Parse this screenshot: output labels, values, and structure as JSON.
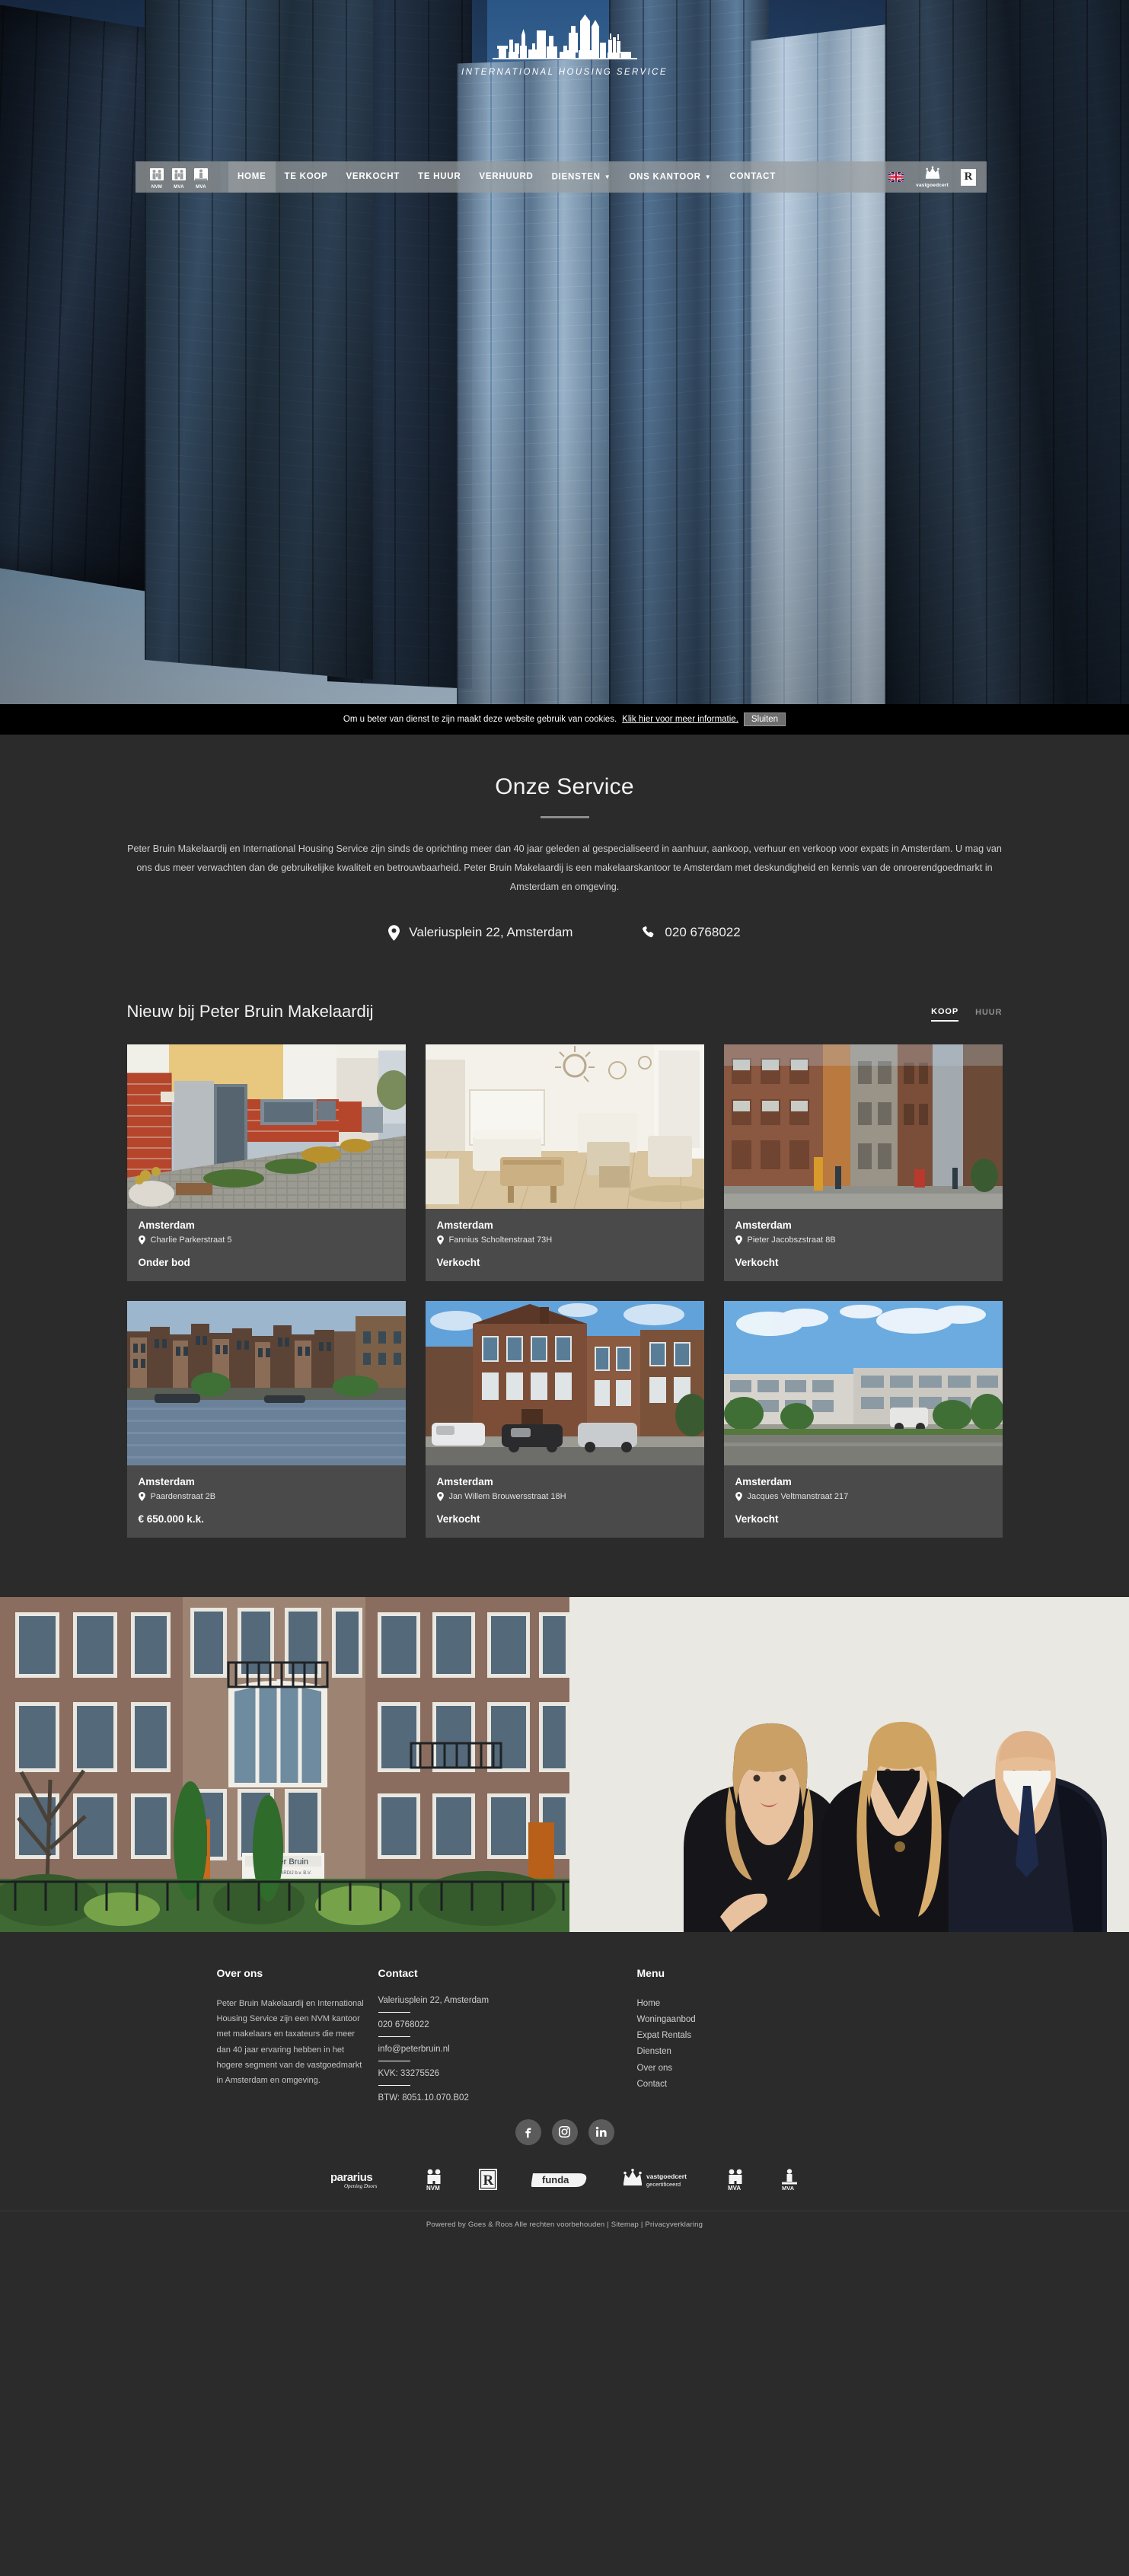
{
  "header": {
    "logo_text": "INTERNATIONAL HOUSING SERVICE",
    "badges": [
      "NVM",
      "MVA",
      "MVA"
    ],
    "nav": [
      {
        "label": "HOME",
        "has_caret": false,
        "active": true
      },
      {
        "label": "TE KOOP",
        "has_caret": false,
        "active": false
      },
      {
        "label": "VERKOCHT",
        "has_caret": false,
        "active": false
      },
      {
        "label": "TE HUUR",
        "has_caret": false,
        "active": false
      },
      {
        "label": "VERHUURD",
        "has_caret": false,
        "active": false
      },
      {
        "label": "DIENSTEN",
        "has_caret": true,
        "active": false
      },
      {
        "label": "ONS KANTOOR",
        "has_caret": true,
        "active": false
      },
      {
        "label": "CONTACT",
        "has_caret": false,
        "active": false
      }
    ],
    "lang_flag": "uk-flag-icon",
    "cert_label": "vastgoedcert",
    "register_mark": "R"
  },
  "cookie": {
    "text": "Om u beter van dienst te zijn maakt deze website gebruik van cookies.",
    "link": "Klik hier voor meer informatie.",
    "button": "Sluiten"
  },
  "service": {
    "title": "Onze Service",
    "paragraph": "Peter Bruin Makelaardij en International Housing Service zijn sinds de oprichting meer dan 40 jaar geleden al gespecialiseerd in aanhuur, aankoop, verhuur en verkoop voor expats in Amsterdam. U mag van ons dus meer verwachten dan de gebruikelijke kwaliteit en betrouwbaarheid. Peter Bruin Makelaardij is een makelaarskantoor te Amsterdam met deskundigheid en kennis van de onroerendgoedmarkt in Amsterdam en omgeving.",
    "address": "Valeriusplein 22, Amsterdam",
    "phone": "020 6768022"
  },
  "listings": {
    "title": "Nieuw bij Peter Bruin Makelaardij",
    "tabs": [
      {
        "label": "KOOP",
        "active": true
      },
      {
        "label": "HUUR",
        "active": false
      }
    ],
    "cards": [
      {
        "city": "Amsterdam",
        "address": "Charlie Parkerstraat 5",
        "status": "Onder bod",
        "photo": "modern-townhouse-entrance"
      },
      {
        "city": "Amsterdam",
        "address": "Fannius Scholtenstraat 73H",
        "status": "Verkocht",
        "photo": "bright-living-room"
      },
      {
        "city": "Amsterdam",
        "address": "Pieter Jacobszstraat 8B",
        "status": "Verkocht",
        "photo": "historic-street-facades"
      },
      {
        "city": "Amsterdam",
        "address": "Paardenstraat 2B",
        "status": "€ 650.000 k.k.",
        "photo": "canal-houses-view"
      },
      {
        "city": "Amsterdam",
        "address": "Jan Willem Brouwersstraat 18H",
        "status": "Verkocht",
        "photo": "brick-mansion-street"
      },
      {
        "city": "Amsterdam",
        "address": "Jacques Veltmanstraat 217",
        "status": "Verkocht",
        "photo": "modern-apartment-block"
      }
    ]
  },
  "banner": {
    "left_image": "peter-bruin-office-facade",
    "right_image": "team-portrait-three-people"
  },
  "footer": {
    "about": {
      "heading": "Over ons",
      "body": "Peter Bruin Makelaardij en International Housing Service zijn een NVM kantoor met makelaars en taxateurs die meer dan 40 jaar ervaring hebben in het hogere segment van de vastgoedmarkt in Amsterdam en omgeving."
    },
    "contact": {
      "heading": "Contact",
      "items": [
        "Valeriusplein 22, Amsterdam",
        "020 6768022",
        "info@peterbruin.nl",
        "KVK: 33275526",
        "BTW: 8051.10.070.B02"
      ]
    },
    "menu": {
      "heading": "Menu",
      "items": [
        "Home",
        "Woningaanbod",
        "Expat Rentals",
        "Diensten",
        "Over ons",
        "Contact"
      ]
    },
    "socials": [
      "facebook-icon",
      "instagram-icon",
      "linkedin-icon"
    ],
    "partners": [
      "pararius",
      "NVM",
      "R",
      "funda",
      "vastgoedcert gecertificeerd",
      "MVA",
      "MVA"
    ],
    "copyright": "Powered by Goes & Roos Alle rechten voorbehouden",
    "sitemap": "Sitemap",
    "privacy": "Privacyverklaring",
    "separator": "|"
  },
  "colors": {
    "page_bg": "#2b2b2b",
    "card_bg": "#4a4a4a",
    "nav_bg": "rgba(152,156,158,0.72)",
    "accent_white": "#ffffff"
  }
}
